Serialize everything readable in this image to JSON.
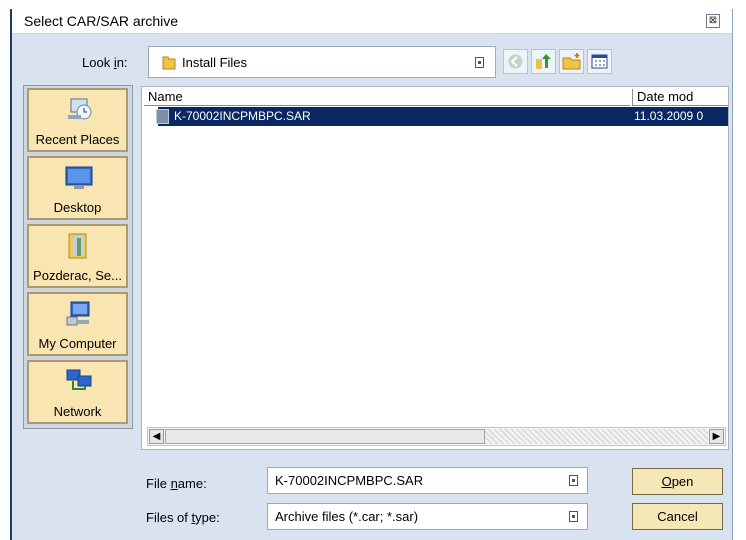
{
  "window": {
    "title": "Select CAR/SAR archive",
    "close_glyph": "⊠"
  },
  "lookin": {
    "label": "Look in:",
    "value": "Install Files",
    "folder_icon": "folder-icon"
  },
  "toolbar": {
    "buttons": [
      "back-icon",
      "up-folder-icon",
      "new-folder-icon",
      "view-menu-icon"
    ]
  },
  "places": [
    {
      "label": "Recent Places",
      "icon": "recent-places-icon"
    },
    {
      "label": "Desktop",
      "icon": "desktop-icon"
    },
    {
      "label": "Pozderac, Se...",
      "icon": "user-folder-icon"
    },
    {
      "label": "My Computer",
      "icon": "computer-icon"
    },
    {
      "label": "Network",
      "icon": "network-icon"
    }
  ],
  "filelist": {
    "columns": [
      "Name",
      "Date mod"
    ],
    "rows": [
      {
        "name": "K-70002INCPMBPC.SAR",
        "date": "11.03.2009 0",
        "selected": true
      }
    ]
  },
  "scrollbar": {
    "left_arrow": "◀",
    "right_arrow": "▶"
  },
  "filename": {
    "label": "File name:",
    "value": "K-70002INCPMBPC.SAR"
  },
  "filetype": {
    "label": "Files of type:",
    "value": "Archive files (*.car; *.sar)"
  },
  "buttons": {
    "open": "Open",
    "cancel": "Cancel"
  },
  "colors": {
    "selection": "#0a2764",
    "places_bg": "#f8e5b1",
    "window_bg": "#d9e3ef"
  }
}
